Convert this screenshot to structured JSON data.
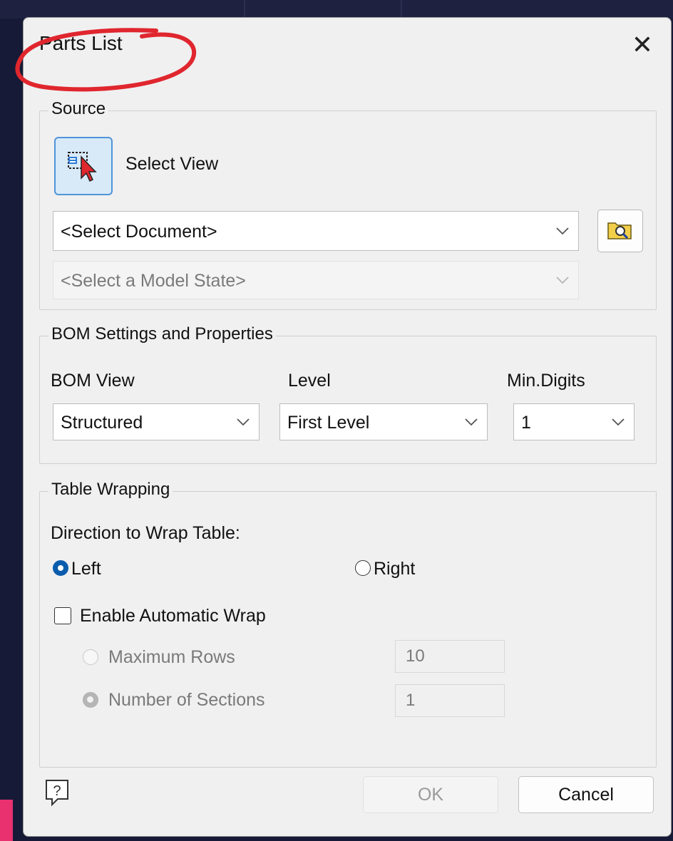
{
  "dialog": {
    "title": "Parts List",
    "close_label": "✕"
  },
  "source": {
    "legend": "Source",
    "select_view_label": "Select View",
    "document_value": "<Select Document>",
    "model_state_value": "<Select a Model State>"
  },
  "bom": {
    "legend": "BOM Settings and Properties",
    "bom_view_label": "BOM View",
    "bom_view_value": "Structured",
    "level_label": "Level",
    "level_value": "First Level",
    "min_digits_label": "Min.Digits",
    "min_digits_value": "1"
  },
  "wrapping": {
    "legend": "Table Wrapping",
    "direction_label": "Direction to Wrap Table:",
    "left_label": "Left",
    "right_label": "Right",
    "selected_direction": "Left",
    "auto_wrap_label": "Enable Automatic Wrap",
    "auto_wrap_checked": false,
    "max_rows_label": "Maximum Rows",
    "max_rows_value": "10",
    "sections_label": "Number of Sections",
    "sections_value": "1"
  },
  "footer": {
    "ok_label": "OK",
    "cancel_label": "Cancel"
  },
  "colors": {
    "accent": "#0b5cad",
    "annotation_red": "#e0262e",
    "highlight_pink": "#e8316e"
  }
}
